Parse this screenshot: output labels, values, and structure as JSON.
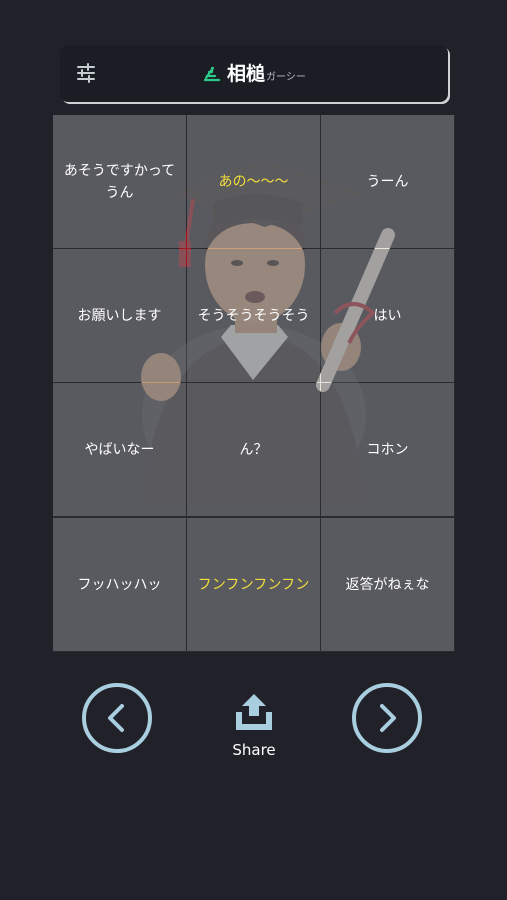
{
  "header": {
    "title": "相槌",
    "subtitle": "ガーシー",
    "settings_icon": "sliders-icon",
    "brand_icon": "stairs-icon",
    "brand_color": "#2ecc8a"
  },
  "grid": {
    "cells": [
      {
        "label": "あそうですかってうん",
        "active": false
      },
      {
        "label": "あの〜〜〜",
        "active": true
      },
      {
        "label": "うーん",
        "active": false
      },
      {
        "label": "お願いします",
        "active": false
      },
      {
        "label": "そうそうそうそう",
        "active": false
      },
      {
        "label": "はい",
        "active": false
      },
      {
        "label": "やばいなー",
        "active": false
      },
      {
        "label": "ん？",
        "active": false
      },
      {
        "label": "コホン",
        "active": false
      },
      {
        "label": "フッハッハッ",
        "active": false
      },
      {
        "label": "フンフンフンフン",
        "active": true
      },
      {
        "label": "返答がねぇな",
        "active": false
      }
    ],
    "active_text_color": "#f4de3c",
    "background_image": "graduate-caricature-illustration"
  },
  "controls": {
    "prev_icon": "chevron-left-icon",
    "next_icon": "chevron-right-icon",
    "share_icon": "upload-tray-icon",
    "share_label": "Share",
    "accent_color": "#a9cee0"
  }
}
